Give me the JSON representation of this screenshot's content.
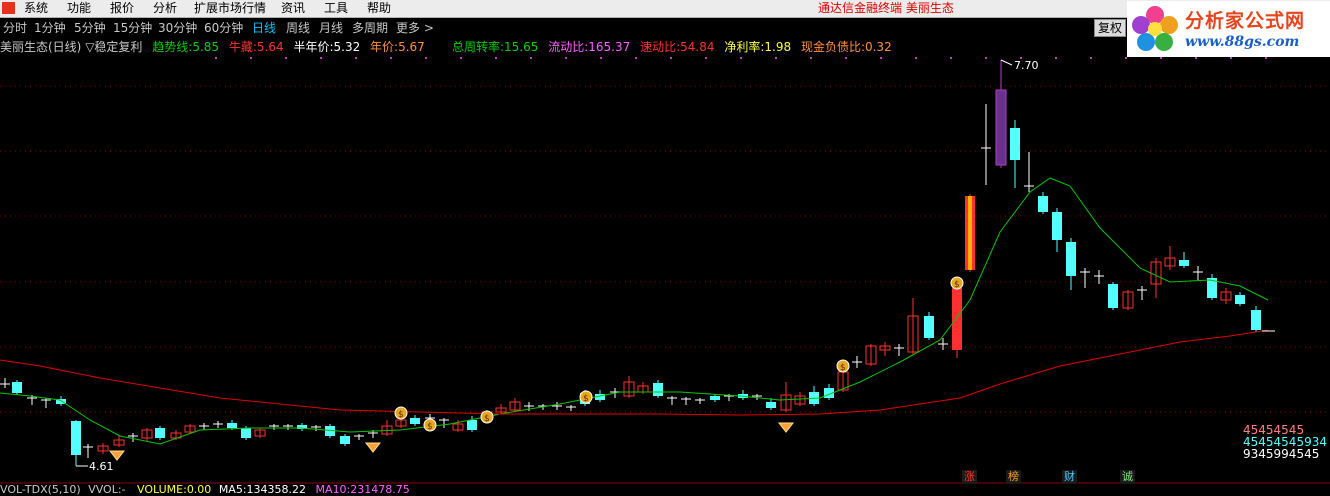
{
  "menubar": {
    "items": [
      "系统",
      "功能",
      "报价",
      "分析",
      "扩展市场行情",
      "资讯",
      "工具",
      "帮助"
    ],
    "app_title": "通达信金融终端",
    "stock_title": "美丽生态"
  },
  "periods": {
    "items": [
      "分时",
      "1分钟",
      "5分钟",
      "15分钟",
      "30分钟",
      "60分钟",
      "日线",
      "周线",
      "月线",
      "多周期",
      "更多 >"
    ],
    "active": "日线"
  },
  "restore_button": "复权",
  "watermark": {
    "text": "分析家公式网",
    "url": "www.88gs.com"
  },
  "info": {
    "title": "美丽生态(日线)",
    "adjust": "▽稳定复利",
    "trend_label": "趋势线:",
    "trend_value": "5.85",
    "bull_label": "牛藏:",
    "bull_value": "5.64",
    "halfyear_label": "半年价:",
    "halfyear_value": "5.32",
    "year_label": "年价:",
    "year_value": "5.67",
    "turnover_label": "总周转率:",
    "turnover_value": "15.65",
    "current_label": "流动比:",
    "current_value": "165.37",
    "quick_label": "速动比:",
    "quick_value": "54.84",
    "margin_label": "净利率:",
    "margin_value": "1.98",
    "debt_label": "现金负债比:",
    "debt_value": "0.32"
  },
  "chart_data": {
    "type": "candlestick",
    "high_label": "7.70",
    "low_label": "4.61",
    "legend_values": [
      "45454545",
      "45454545934",
      "9345994545"
    ],
    "tags": [
      "涨",
      "榜",
      "财",
      "诚"
    ],
    "colors": {
      "up": "#ff3030",
      "down": "#54ffff",
      "trend": "#00c800",
      "halfyear": "#e00000",
      "grid": "#8b0000"
    }
  },
  "volume": {
    "name": "VOL-TDX(5,10)",
    "vvol_label": "VVOL:",
    "vvol_value": "-",
    "volume_label": "VOLUME:",
    "volume_value": "0.00",
    "ma5_label": "MA5:",
    "ma5_value": "134358.22",
    "ma10_label": "MA10:",
    "ma10_value": "231478.75"
  }
}
